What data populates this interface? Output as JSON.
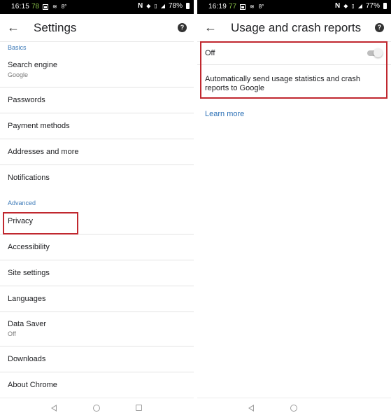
{
  "colors": {
    "accent": "#3c7ab8",
    "highlight": "#c0282f",
    "statusbar": "#000000",
    "battery_number": "#8bc34a"
  },
  "left": {
    "statusbar": {
      "time": "16:15",
      "num": "78",
      "icons": [
        "image-icon",
        "cast-icon",
        "8°"
      ],
      "right_icons": [
        "nfc-icon",
        "wifi-icon",
        "vibrate-icon",
        "signal-icon"
      ],
      "battery": "78%"
    },
    "appbar": {
      "title": "Settings",
      "back_icon": "arrow-back-icon",
      "help_icon": "help-icon"
    },
    "sections": {
      "basics": "Basics",
      "advanced": "Advanced"
    },
    "items": {
      "search_engine": {
        "title": "Search engine",
        "subtitle": "Google"
      },
      "passwords": {
        "title": "Passwords"
      },
      "payment_methods": {
        "title": "Payment methods"
      },
      "addresses": {
        "title": "Addresses and more"
      },
      "notifications": {
        "title": "Notifications"
      },
      "privacy": {
        "title": "Privacy"
      },
      "accessibility": {
        "title": "Accessibility"
      },
      "site_settings": {
        "title": "Site settings"
      },
      "languages": {
        "title": "Languages"
      },
      "data_saver": {
        "title": "Data Saver",
        "subtitle": "Off"
      },
      "downloads": {
        "title": "Downloads"
      },
      "about_chrome": {
        "title": "About Chrome"
      }
    }
  },
  "right": {
    "statusbar": {
      "time": "16:19",
      "num": "77",
      "icons": [
        "image-icon",
        "cast-icon",
        "8°"
      ],
      "right_icons": [
        "nfc-icon",
        "wifi-icon",
        "vibrate-icon",
        "signal-icon"
      ],
      "battery": "77%"
    },
    "appbar": {
      "title": "Usage and crash reports",
      "back_icon": "arrow-back-icon",
      "help_icon": "help-icon"
    },
    "toggle": {
      "label": "Off",
      "checked": false
    },
    "description": "Automatically send usage statistics and crash reports to Google",
    "learn_more": "Learn more"
  }
}
